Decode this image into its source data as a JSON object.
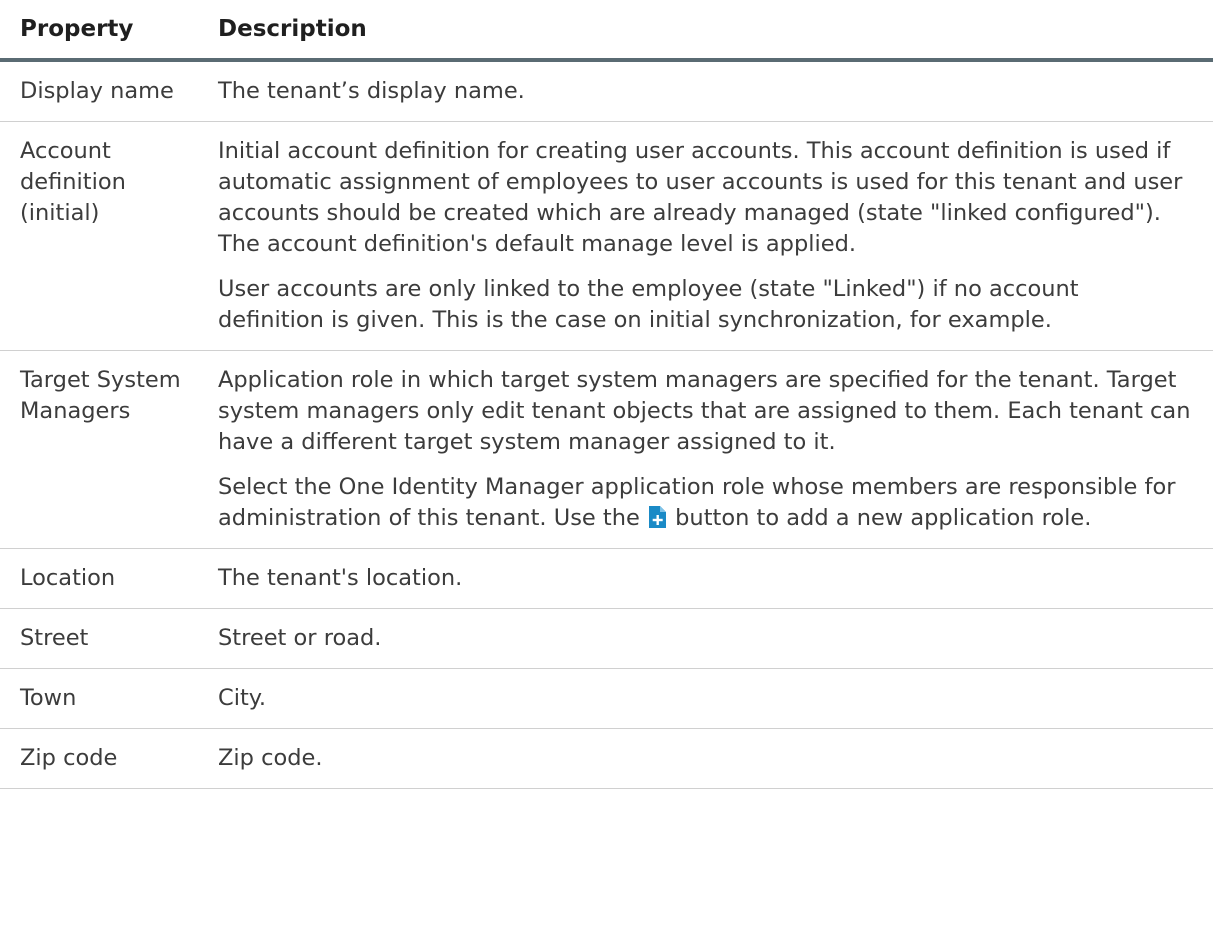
{
  "table": {
    "header": {
      "property": "Property",
      "description": "Description"
    },
    "rows": [
      {
        "property": "Display name",
        "description": [
          "The tenant’s display name."
        ]
      },
      {
        "property": "Account definition (initial)",
        "description": [
          "Initial account definition for creating user accounts. This account definition is used if automatic assignment of employees to user accounts is used for this tenant and user accounts should be created which are already managed (state \"linked configured\"). The account definition's default manage level is applied.",
          "User accounts are only linked to the employee (state \"Linked\") if no account definition is given. This is the case on initial synchronization, for example."
        ]
      },
      {
        "property": "Target System Managers",
        "description": [
          "Application role in which target system managers are specified for the tenant. Target system managers only edit tenant objects that are assigned to them. Each tenant can have a different target system manager assigned to it."
        ],
        "description_with_icon": {
          "before": "Select the One Identity Manager application role whose members are responsible for administration of this tenant. Use the ",
          "icon": "add-new-icon",
          "after": " button to add a new application role."
        }
      },
      {
        "property": "Location",
        "description": [
          "The tenant's location."
        ]
      },
      {
        "property": "Street",
        "description": [
          "Street or road."
        ]
      },
      {
        "property": "Town",
        "description": [
          "City."
        ]
      },
      {
        "property": "Zip code",
        "description": [
          "Zip code."
        ]
      }
    ]
  },
  "colors": {
    "header_rule": "#5a6b73",
    "row_rule": "#d0d0d0",
    "text": "#3c3c3c",
    "icon_blue": "#1a8ac6"
  }
}
